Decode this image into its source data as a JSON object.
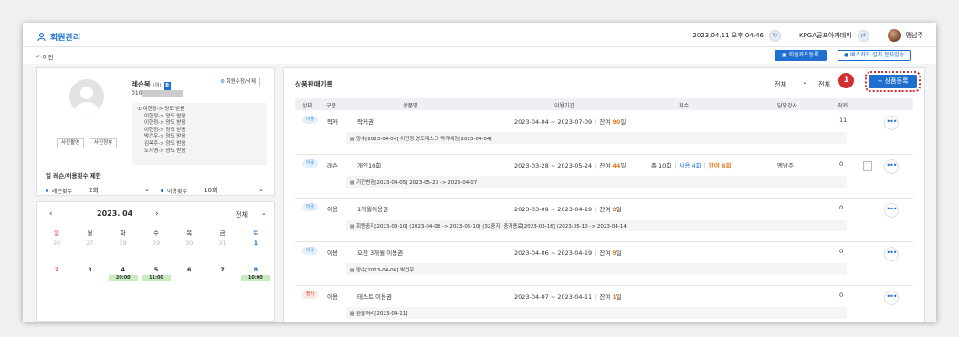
{
  "header": {
    "brand": "회원관리",
    "datetime": "2023.04.11 오후 04:46",
    "org": "KPGA골프아카데미",
    "user": "맹남주"
  },
  "subbar": {
    "back": "이전",
    "card_btn": "회원카드등록",
    "sms_btn": "배스카드 설치 문자발송"
  },
  "member": {
    "name": "레슨북",
    "tag": "(여)",
    "badge": "B",
    "phone": "010",
    "edit": "회원수정/삭제",
    "photo_btn": "사진촬영",
    "photo_info": "사진정부",
    "notes": [
      "① 이현정-> 양도 받음",
      "이현정-> 양도 받음",
      "이현정-> 양도 받음",
      "이현정-> 양도 받음",
      "박건우-> 양도 받음",
      "김옥주-> 양도 받음",
      "노시영-> 양도 받음"
    ],
    "limit_title": "일 레슨/이용횟수 제한",
    "lesson_label": "레슨횟수",
    "lesson_val": "2회",
    "use_label": "이용횟수",
    "use_val": "10회"
  },
  "calendar": {
    "month": "2023. 04",
    "filter": "전체",
    "dow": [
      "일",
      "월",
      "화",
      "수",
      "목",
      "금",
      "토"
    ],
    "week1": [
      "26",
      "27",
      "28",
      "29",
      "30",
      "31",
      "1"
    ],
    "week2": [
      "2",
      "3",
      "4",
      "5",
      "6",
      "7",
      "8"
    ],
    "times": {
      "4": "20:00",
      "5": "11:00",
      "8": "10:00"
    }
  },
  "sales": {
    "title": "상품판매기록",
    "filter1": "전체",
    "filter2": "전체",
    "add": "+ 상품등록",
    "step": "1",
    "headers": [
      "상태",
      "구분",
      "상품명",
      "이용기간",
      "횟수",
      "담당강사",
      "락커"
    ],
    "rows": [
      {
        "status": "이용",
        "type": "락커",
        "name": "락커권",
        "period": "2023-04-04 ~ 2023-07-09",
        "remain_pre": "잔여 ",
        "remain": "90",
        "remain_suf": "일",
        "count_total": "",
        "count_used": "",
        "count_left": "",
        "teacher": "",
        "locker": "11",
        "note": "양수[2023-04-04] 이현정 영도테스크 락커배정[2023-04-04]"
      },
      {
        "status": "이용",
        "type": "레슨",
        "name": "개인10회",
        "period": "2023-03-28 ~ 2023-05-24",
        "remain_pre": "잔여 ",
        "remain": "44",
        "remain_suf": "일",
        "count_total": "총 10회",
        "count_used": "사용 4회",
        "count_left": "잔여 6회",
        "teacher": "맹남주",
        "locker": "0",
        "note": "기간변경[2023-04-05] 2023-05-23 -> 2023-04-07"
      },
      {
        "status": "이용",
        "type": "이용",
        "name": "1개월이용권",
        "period": "2023-03-09 ~ 2023-04-19",
        "remain_pre": "잔여 ",
        "remain": "9",
        "remain_suf": "일",
        "count_total": "",
        "count_used": "",
        "count_left": "",
        "teacher": "",
        "locker": "0",
        "note": "회원중지[2023-03-10] (2023-04-08 -> 2023-05-10) (32중지) 중지종료[2023-03-16] (2023-05-10 -> 2023-04-14"
      },
      {
        "status": "이용",
        "type": "이용",
        "name": "오전 3개월 이용권",
        "period": "2023-04-06 ~ 2023-04-19",
        "remain_pre": "잔여 ",
        "remain": "9",
        "remain_suf": "일",
        "count_total": "",
        "count_used": "",
        "count_left": "",
        "teacher": "",
        "locker": "0",
        "note": "양수[2023-04-06] 박건우"
      },
      {
        "status": "정지",
        "type": "이용",
        "name": "테스트 이용권",
        "period": "2023-04-07 ~ 2023-04-11",
        "remain_pre": "잔여 ",
        "remain": "1",
        "remain_suf": "일",
        "count_total": "",
        "count_used": "",
        "count_left": "",
        "teacher": "",
        "locker": "0",
        "note": "환불처리[2023-04-11]"
      }
    ]
  }
}
